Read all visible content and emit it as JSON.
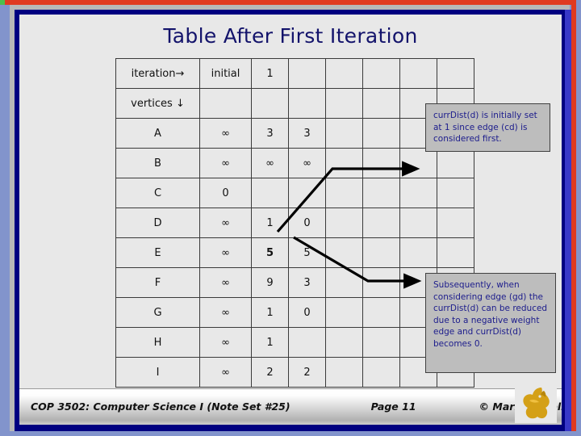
{
  "slide": {
    "title": "Table After First Iteration"
  },
  "table": {
    "header": {
      "iteration_label": "iteration",
      "iteration_arrow": "→",
      "vertices_label": "vertices",
      "vertices_arrow": "↓",
      "columns": [
        "initial",
        "1",
        "",
        "",
        "",
        "",
        ""
      ]
    },
    "rows": [
      {
        "vertex": "A",
        "cells": [
          "∞",
          "3",
          "3",
          "",
          "",
          "",
          ""
        ]
      },
      {
        "vertex": "B",
        "cells": [
          "∞",
          "∞",
          "∞",
          "",
          "",
          "",
          ""
        ]
      },
      {
        "vertex": "C",
        "cells": [
          "0",
          "",
          "",
          "",
          "",
          "",
          ""
        ]
      },
      {
        "vertex": "D",
        "cells": [
          "∞",
          "1",
          "0",
          "",
          "",
          "",
          ""
        ]
      },
      {
        "vertex": "E",
        "cells": [
          "∞",
          "5",
          "5",
          "",
          "",
          "",
          ""
        ]
      },
      {
        "vertex": "F",
        "cells": [
          "∞",
          "9",
          "3",
          "",
          "",
          "",
          ""
        ]
      },
      {
        "vertex": "G",
        "cells": [
          "∞",
          "1",
          "0",
          "",
          "",
          "",
          ""
        ]
      },
      {
        "vertex": "H",
        "cells": [
          "∞",
          "1",
          "",
          "",
          "",
          "",
          ""
        ]
      },
      {
        "vertex": "I",
        "cells": [
          "∞",
          "2",
          "2",
          "",
          "",
          "",
          ""
        ]
      }
    ],
    "highlight_navy_cell": "vertices-row-initial-column",
    "highlight_cyan_cells": [
      "D-2",
      "F-2",
      "G-2"
    ],
    "colors": {
      "navy_cell": "#0000a0",
      "cyan_cell": "#00ffff",
      "cell_background": "#e8e8e8",
      "grid_line": "#3a3a3a"
    }
  },
  "callouts": [
    {
      "id": "callout-1",
      "text": "currDist(d) is initially set at 1 since edge (cd) is considered first."
    },
    {
      "id": "callout-2",
      "text": "Subsequently, when considering edge (gd) the currDist(d) can be reduced due to a negative weight edge and currDist(d) becomes 0."
    }
  ],
  "footer": {
    "course": "COP 3502: Computer Science I  (Note Set #25)",
    "page": "Page 11",
    "credit": "© Mark Llewellyn"
  },
  "theme": {
    "title_color": "#13136b",
    "callout_text_color": "#1c1c8c",
    "callout_background": "#bdbdbd",
    "slide_background": "#e8e8e8",
    "frame_green": "#4dbf4d",
    "frame_red": "#e03a20",
    "frame_navy": "#000080",
    "frame_violet": "#8294cc",
    "logo_gold": "#d4a017"
  }
}
